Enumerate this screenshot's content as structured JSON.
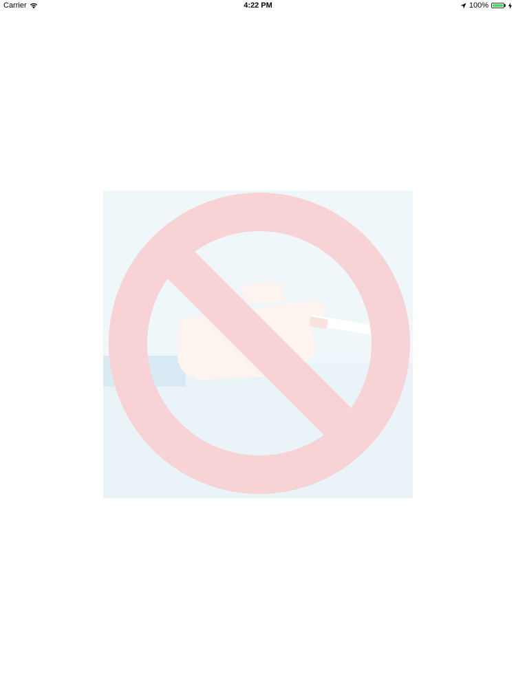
{
  "status_bar": {
    "carrier": "Carrier",
    "time": "4:22 PM",
    "battery_percent": "100%",
    "battery_level": 1.0
  },
  "icons": {
    "wifi": "wifi-icon",
    "location": "location-arrow-icon",
    "battery": "battery-icon",
    "charging": "charging-bolt-icon",
    "prohibition": "no-smoking-icon"
  },
  "colors": {
    "prohibition_red": "#f7d3d6",
    "background_tint": "#eff7fa",
    "battery_green": "#4cd964"
  }
}
